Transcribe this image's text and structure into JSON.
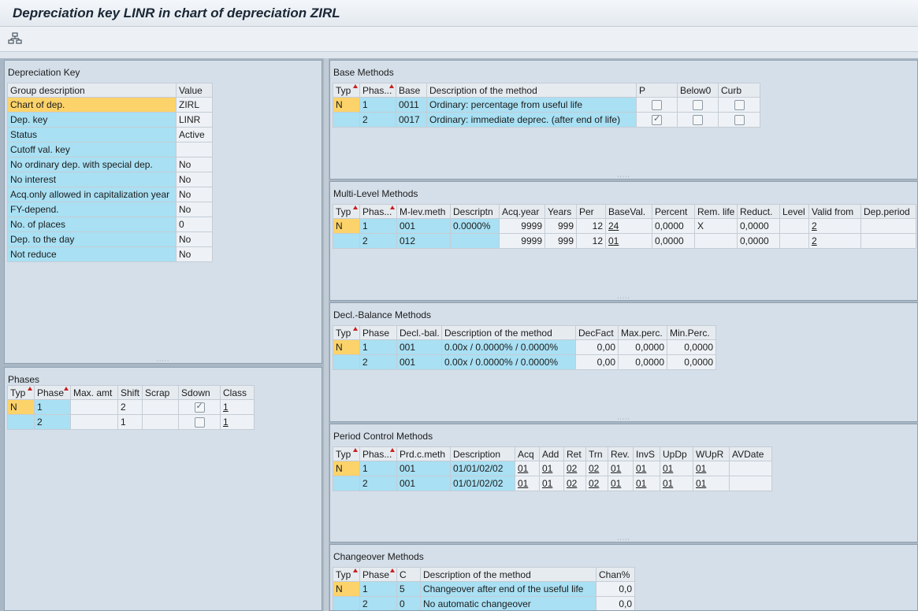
{
  "window": {
    "title": "Depreciation key LINR in chart of depreciation ZIRL"
  },
  "toolbar": {
    "icon": "hierarchy-structure-icon"
  },
  "depkey": {
    "title": "Depreciation Key",
    "headers": [
      "Group description",
      "Value"
    ],
    "rows": [
      [
        "Chart of dep.",
        "ZIRL"
      ],
      [
        "Dep. key",
        "LINR"
      ],
      [
        "Status",
        "Active"
      ],
      [
        "Cutoff val. key",
        ""
      ],
      [
        "No ordinary dep. with special dep.",
        "No"
      ],
      [
        "No interest",
        "No"
      ],
      [
        "Acq.only allowed in capitalization year",
        "No"
      ],
      [
        "FY-depend.",
        "No"
      ],
      [
        "No. of places",
        "0"
      ],
      [
        "Dep. to the day",
        "No"
      ],
      [
        "Not reduce",
        "No"
      ]
    ]
  },
  "phases": {
    "title": "Phases",
    "headers": [
      "Typ",
      "Phase",
      "Max. amt",
      "Shift",
      "Scrap",
      "Sdown",
      "Class"
    ],
    "rows": [
      {
        "typ": "N",
        "phase": "1",
        "max": "",
        "shift": "2",
        "scrap": "",
        "sdown": true,
        "class": "1"
      },
      {
        "typ": "",
        "phase": "2",
        "max": "",
        "shift": "1",
        "scrap": "",
        "sdown": false,
        "class": "1"
      }
    ]
  },
  "base": {
    "title": "Base Methods",
    "headers": [
      "Typ",
      "Phas...",
      "Base",
      "Description of the method",
      "P",
      "Below0",
      "Curb"
    ],
    "rows": [
      {
        "typ": "N",
        "phase": "1",
        "base": "0011",
        "desc": "Ordinary: percentage from useful life",
        "p": false,
        "below0": false,
        "curb": false
      },
      {
        "typ": "",
        "phase": "2",
        "base": "0017",
        "desc": "Ordinary: immediate deprec. (after end of life)",
        "p": true,
        "below0": false,
        "curb": false
      }
    ]
  },
  "multi": {
    "title": "Multi-Level Methods",
    "headers": [
      "Typ",
      "Phas...",
      "M-lev.meth",
      "Descriptn",
      "Acq.year",
      "Years",
      "Per",
      "BaseVal.",
      "Percent",
      "Rem. life",
      "Reduct.",
      "Level",
      "Valid from",
      "Dep.period"
    ],
    "rows": [
      [
        "N",
        "1",
        "001",
        "0.0000%",
        "9999",
        "999",
        "12",
        "24",
        "0,0000",
        "X",
        "0,0000",
        "",
        "2",
        ""
      ],
      [
        "",
        "2",
        "012",
        "",
        "9999",
        "999",
        "12",
        "01",
        "0,0000",
        "",
        "0,0000",
        "",
        "2",
        ""
      ]
    ]
  },
  "decl": {
    "title": "Decl.-Balance Methods",
    "headers": [
      "Typ",
      "Phase",
      "Decl.-bal.",
      "Description of the method",
      "DecFact",
      "Max.perc.",
      "Min.Perc."
    ],
    "rows": [
      [
        "N",
        "1",
        "001",
        "0.00x / 0.0000% / 0.0000%",
        "0,00",
        "0,0000",
        "0,0000"
      ],
      [
        "",
        "2",
        "001",
        "0.00x / 0.0000% / 0.0000%",
        "0,00",
        "0,0000",
        "0,0000"
      ]
    ]
  },
  "period": {
    "title": "Period Control Methods",
    "headers": [
      "Typ",
      "Phas...",
      "Prd.c.meth",
      "Description",
      "Acq",
      "Add",
      "Ret",
      "Trn",
      "Rev.",
      "InvS",
      "UpDp",
      "WUpR",
      "AVDate"
    ],
    "rows": [
      [
        "N",
        "1",
        "001",
        "01/01/02/02",
        "01",
        "01",
        "02",
        "02",
        "01",
        "01",
        "01",
        "01",
        ""
      ],
      [
        "",
        "2",
        "001",
        "01/01/02/02",
        "01",
        "01",
        "02",
        "02",
        "01",
        "01",
        "01",
        "01",
        ""
      ]
    ]
  },
  "change": {
    "title": "Changeover Methods",
    "headers": [
      "Typ",
      "Phase",
      "C",
      "Description of the method",
      "Chan%"
    ],
    "rows": [
      [
        "N",
        "1",
        "5",
        "Changeover after end of the useful life",
        "0,0"
      ],
      [
        "",
        "2",
        "0",
        "No automatic changeover",
        "0,0"
      ]
    ]
  },
  "colors": {
    "key_cell": "#a9e0f3",
    "selected_cell": "#fbd36a",
    "pane_bg": "#d5dfe9"
  }
}
